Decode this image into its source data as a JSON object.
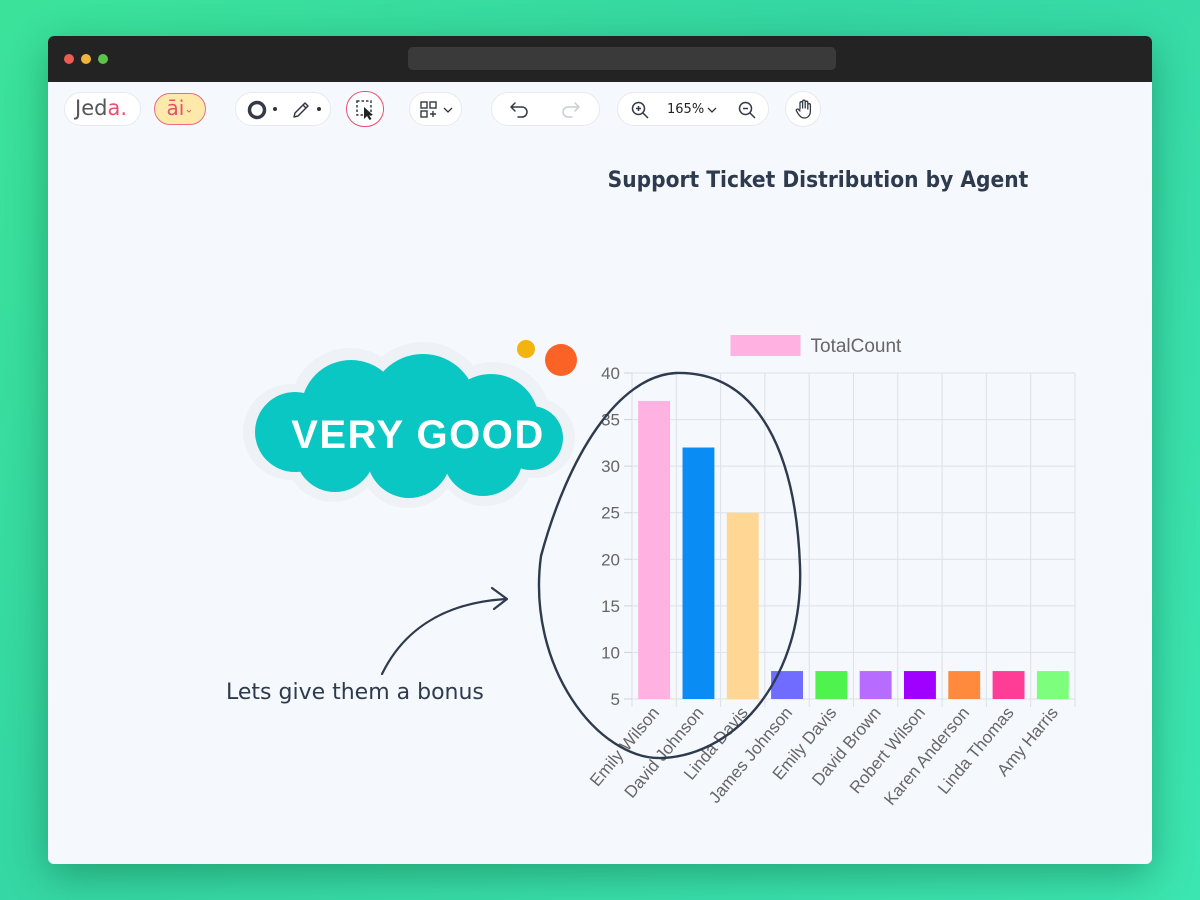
{
  "app": {
    "logo_main": "Jed",
    "logo_accent": "a.",
    "ai_label": "āi"
  },
  "toolbar": {
    "zoom_level": "165%",
    "icons": [
      "ai-icon",
      "circle-shape-icon",
      "pencil-icon",
      "select-arrow-icon",
      "apps-grid-icon",
      "undo-icon",
      "redo-icon",
      "zoom-in-icon",
      "zoom-out-icon",
      "hand-icon"
    ]
  },
  "canvas": {
    "sticker_text": "VERY GOOD",
    "annotation_text": "Lets give them a bonus"
  },
  "chart_data": {
    "type": "bar",
    "title": "Support Ticket Distribution by Agent",
    "xlabel": "",
    "ylabel": "",
    "categories": [
      "Emily Wilson",
      "David Johnson",
      "Linda Davis",
      "James Johnson",
      "Emily Davis",
      "David Brown",
      "Robert Wilson",
      "Karen Anderson",
      "Linda Thomas",
      "Amy Harris"
    ],
    "series": [
      {
        "name": "TotalCount",
        "values": [
          37,
          32,
          25,
          8,
          8,
          8,
          8,
          8,
          8,
          8
        ]
      }
    ],
    "colors": [
      "#ffb1e1",
      "#0a8cf5",
      "#ffd794",
      "#6f6cff",
      "#4ef34e",
      "#b76cff",
      "#9f00ff",
      "#ff8a3d",
      "#ff3d97",
      "#7dff7d"
    ],
    "ylim": [
      5,
      40
    ],
    "yticks": [
      5,
      10,
      15,
      20,
      25,
      30,
      35,
      40
    ],
    "legend_position": "top",
    "grid": true
  }
}
